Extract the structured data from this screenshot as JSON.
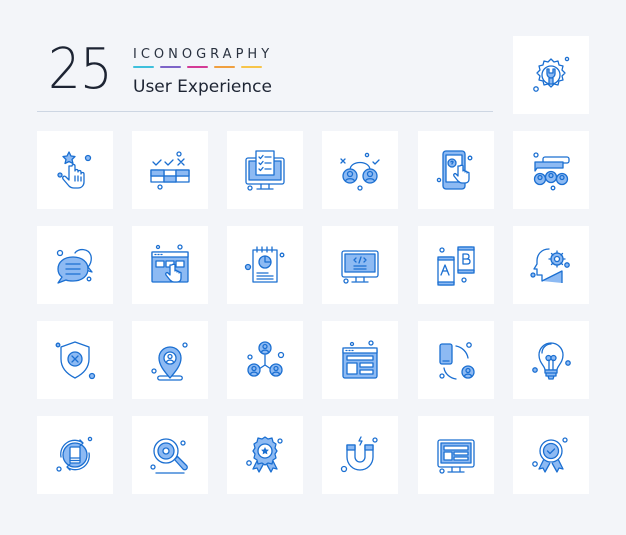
{
  "header": {
    "count": "25",
    "brand": "ICONOGRAPHY",
    "title": "User Experience",
    "color_bars": [
      "#3fc0dc",
      "#7d64c8",
      "#d43b96",
      "#f0a040",
      "#f7c54a"
    ]
  },
  "featured_icon": "settings-wrench-gear-icon",
  "colors": {
    "stroke": "#1b6fd1",
    "fill": "#8dbaf3",
    "tile_bg": "#ffffff",
    "page_bg": "#f3f5f9"
  },
  "icons": [
    [
      "hand-star-tap-icon",
      "checklist-grid-icon",
      "monitor-checklist-icon",
      "user-choice-icon",
      "mobile-help-tap-icon",
      "group-chat-users-icon"
    ],
    [
      "chat-bubbles-icon",
      "browser-click-icon",
      "notebook-pie-chart-icon",
      "monitor-code-icon",
      "ab-testing-mobile-icon",
      "head-gear-icon"
    ],
    [
      "shield-x-icon",
      "location-user-pin-icon",
      "user-network-icon",
      "browser-layout-icon",
      "mobile-user-sync-icon",
      "lightbulb-icon"
    ],
    [
      "mobile-refresh-icon",
      "search-gear-icon",
      "badge-star-icon",
      "magnet-icon",
      "monitor-layout-icon",
      "badge-check-icon"
    ]
  ]
}
